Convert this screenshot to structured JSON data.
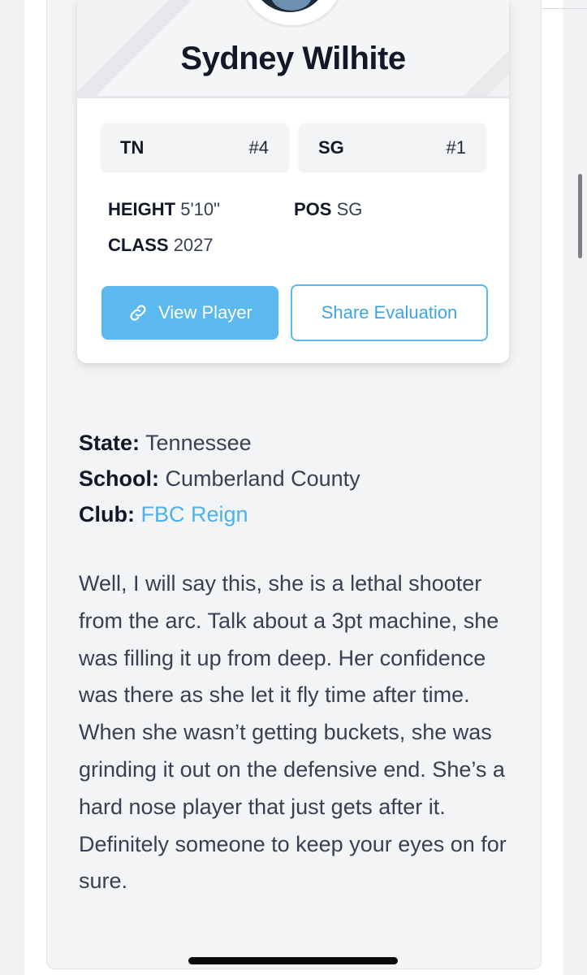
{
  "player": {
    "name": "Sydney Wilhite"
  },
  "badges": [
    {
      "label": "TN",
      "rank": "#4"
    },
    {
      "label": "SG",
      "rank": "#1"
    }
  ],
  "stats": {
    "height_label": "HEIGHT",
    "height_value": "5'10\"",
    "pos_label": "POS",
    "pos_value": "SG",
    "class_label": "CLASS",
    "class_value": "2027"
  },
  "buttons": {
    "view_player": "View Player",
    "share_evaluation": "Share Evaluation",
    "view_player_icon": "link-icon"
  },
  "details": {
    "state_label": "State:",
    "state_value": "Tennessee",
    "school_label": "School:",
    "school_value": "Cumberland County",
    "club_label": "Club:",
    "club_value": "FBC Reign"
  },
  "evaluation": {
    "text": "Well, I will say this, she is a lethal shooter from the arc. Talk about a 3pt machine, she was filling it up from deep. Her confidence was there as she let it fly time after time. When she wasn’t getting buckets, she was grinding it out on the defensive end. She’s a hard nose player that just gets after it. Definitely someone to keep your eyes on for sure."
  },
  "colors": {
    "accent": "#5bb9ef",
    "link": "#4db2ea",
    "card_bg": "#ffffff",
    "page_bg": "#f3f4f6"
  }
}
